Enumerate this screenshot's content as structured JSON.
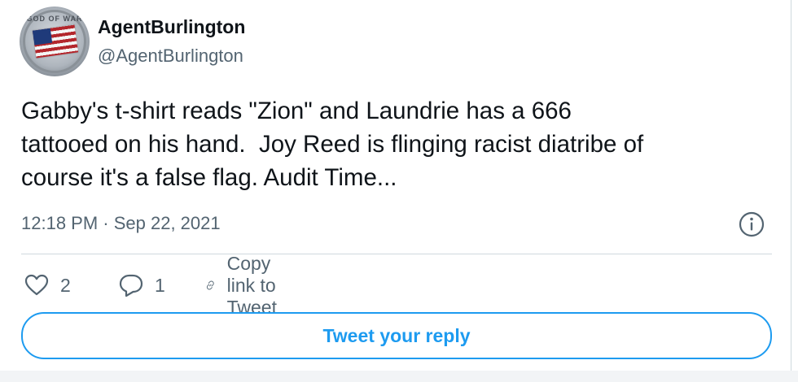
{
  "author": {
    "display_name": "AgentBurlington",
    "handle": "@AgentBurlington",
    "avatar_caption": "GOD OF WAR"
  },
  "tweet": {
    "text": "Gabby's t-shirt reads \"Zion\" and Laundrie has a 666\ntattooed on his hand.  Joy Reed is flinging racist diatribe of\ncourse it's a false flag. Audit Time...",
    "timestamp": "12:18 PM · Sep 22, 2021"
  },
  "actions": {
    "like_count": "2",
    "reply_count": "1",
    "copy_link_label": "Copy link to Tweet"
  },
  "reply_button": {
    "label": "Tweet your reply"
  },
  "colors": {
    "accent": "#1d9bf0",
    "text_primary": "#0f1419",
    "text_secondary": "#536471",
    "divider": "#cfd9de"
  },
  "icons": {
    "info": "info-icon",
    "like": "heart-icon",
    "reply": "speech-bubble-icon",
    "copy_link": "link-icon"
  }
}
